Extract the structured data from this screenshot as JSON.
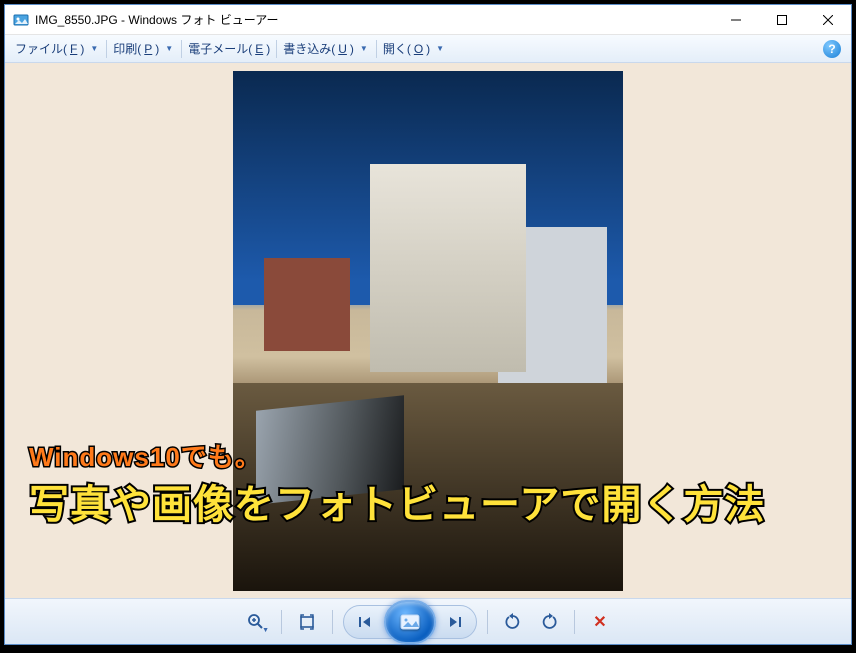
{
  "titlebar": {
    "title": "IMG_8550.JPG - Windows フォト ビューアー"
  },
  "menubar": {
    "file": {
      "label": "ファイル(",
      "mn": "F",
      "suffix": ")"
    },
    "print": {
      "label": "印刷(",
      "mn": "P",
      "suffix": ")"
    },
    "email": {
      "label": "電子メール(",
      "mn": "E",
      "suffix": ")"
    },
    "burn": {
      "label": "書き込み(",
      "mn": "U",
      "suffix": ")"
    },
    "open": {
      "label": "開く(",
      "mn": "O",
      "suffix": ")"
    }
  },
  "overlay": {
    "line1": "Windows10でも。",
    "line2": "写真や画像をフォトビューアで開く方法"
  },
  "toolbar": {
    "zoom": "ズーム",
    "fit": "フィット",
    "prev": "前へ",
    "play": "スライドショー",
    "next": "次へ",
    "rotate_ccw": "左回転",
    "rotate_cw": "右回転",
    "delete": "削除"
  }
}
